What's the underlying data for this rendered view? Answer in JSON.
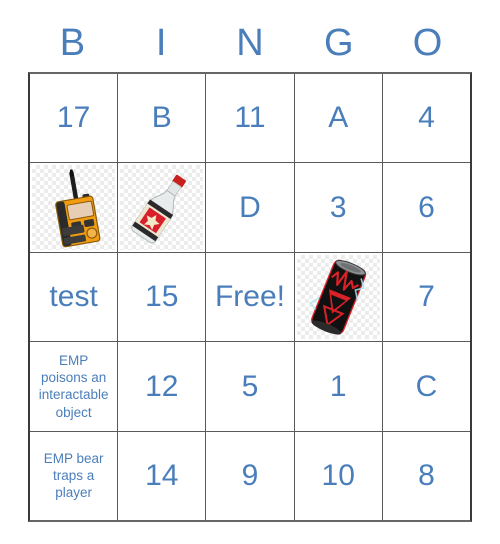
{
  "card": {
    "title": "BINGO",
    "headers": [
      "B",
      "I",
      "N",
      "G",
      "O"
    ],
    "accent_color": "#4a7ebb",
    "border_color": "#5a5a5a",
    "rows": [
      [
        {
          "kind": "text",
          "value": "17"
        },
        {
          "kind": "text",
          "value": "B"
        },
        {
          "kind": "text",
          "value": "11"
        },
        {
          "kind": "text",
          "value": "A"
        },
        {
          "kind": "text",
          "value": "4"
        }
      ],
      [
        {
          "kind": "image",
          "value": "walkie-talkie-radio"
        },
        {
          "kind": "image",
          "value": "liquor-bottle"
        },
        {
          "kind": "text",
          "value": "D"
        },
        {
          "kind": "text",
          "value": "3"
        },
        {
          "kind": "text",
          "value": "6"
        }
      ],
      [
        {
          "kind": "text",
          "value": "test"
        },
        {
          "kind": "text",
          "value": "15"
        },
        {
          "kind": "text",
          "value": "Free!"
        },
        {
          "kind": "image",
          "value": "energy-drink-can"
        },
        {
          "kind": "text",
          "value": "7"
        }
      ],
      [
        {
          "kind": "text",
          "value": "EMP poisons an interactable object",
          "size": "small"
        },
        {
          "kind": "text",
          "value": "12"
        },
        {
          "kind": "text",
          "value": "5"
        },
        {
          "kind": "text",
          "value": "1"
        },
        {
          "kind": "text",
          "value": "C"
        }
      ],
      [
        {
          "kind": "text",
          "value": "EMP bear traps a player",
          "size": "small"
        },
        {
          "kind": "text",
          "value": "14"
        },
        {
          "kind": "text",
          "value": "9"
        },
        {
          "kind": "text",
          "value": "10"
        },
        {
          "kind": "text",
          "value": "8"
        }
      ]
    ]
  }
}
